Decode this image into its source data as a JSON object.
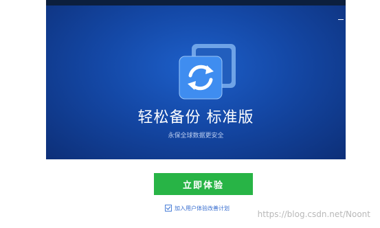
{
  "banner": {
    "title": "轻松备份  标准版",
    "subtitle": "永保全球数据更安全",
    "close_label": "—"
  },
  "logo": {
    "icon": "sync-arrows-icon"
  },
  "actions": {
    "primary_label": "立即体验",
    "join_label": "加入用户体验改善计划",
    "join_checked": true
  },
  "watermark": "https://blog.csdn.net/Noont",
  "colors": {
    "banner_blue": "#1448a6",
    "accent_green": "#28b446",
    "link_blue": "#3a6fd0"
  }
}
